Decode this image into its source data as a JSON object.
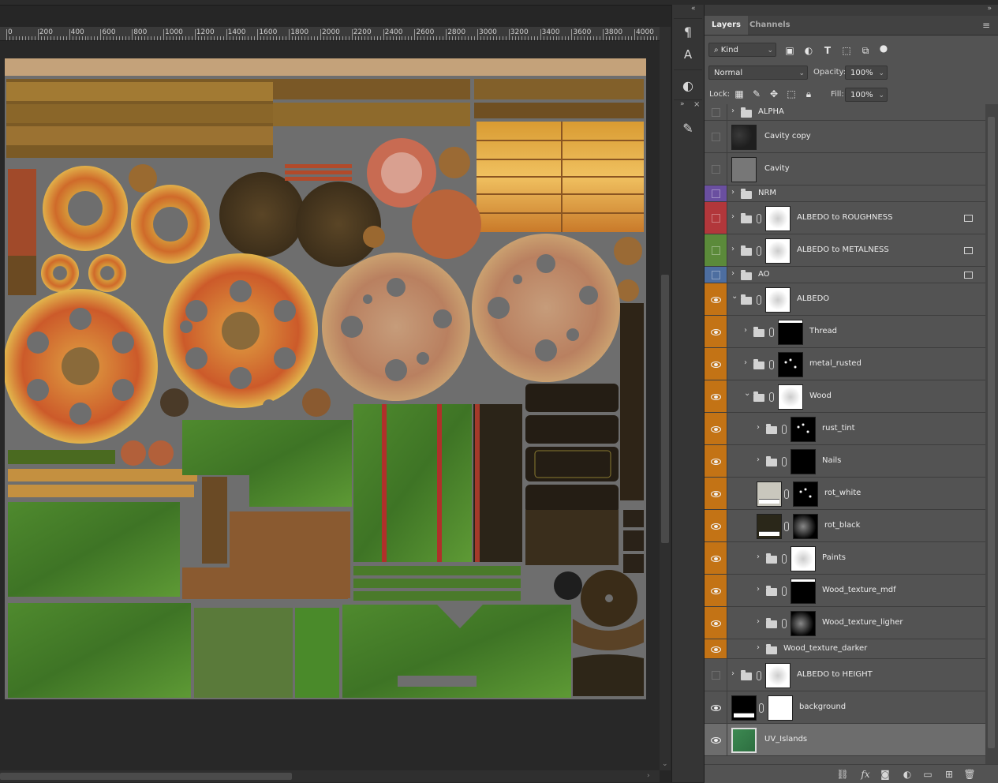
{
  "ruler": {
    "labels": [
      "0",
      "200",
      "400",
      "600",
      "800",
      "1000",
      "1200",
      "1400",
      "1600",
      "1800",
      "2000",
      "2200",
      "2400",
      "2600",
      "2800",
      "3000",
      "3200",
      "3400",
      "3600",
      "3800",
      "4000"
    ]
  },
  "dock": {
    "collapse_glyph": "«",
    "expand_glyph": "»",
    "close_glyph": "×"
  },
  "panel": {
    "collapse_glyph": "»",
    "tabs": [
      "Layers",
      "Channels"
    ],
    "menu_glyph": "≡",
    "filter": {
      "label": "Kind",
      "search_glyph": "⌕"
    },
    "blend_mode": "Normal",
    "opacity": {
      "label": "Opacity:",
      "value": "100%"
    },
    "lock": {
      "label": "Lock:"
    },
    "fill": {
      "label": "Fill:",
      "value": "100%"
    }
  },
  "colors": {
    "purple": "#6a4fa0",
    "red": "#b2373b",
    "green": "#5b8a3a",
    "blue": "#4d6ea0",
    "orange": "#c37315",
    "selected": "#6d6d6d"
  },
  "layers": [
    {
      "name": "ALPHA",
      "type": "group",
      "visible": false,
      "color": "",
      "indent": 0,
      "expanded": false
    },
    {
      "name": "Cavity copy",
      "type": "pixel",
      "visible": false,
      "color": "",
      "indent": 0,
      "thumb": "dark-noise"
    },
    {
      "name": "Cavity",
      "type": "pixel",
      "visible": false,
      "color": "",
      "indent": 0,
      "thumb": "gray"
    },
    {
      "name": "NRM",
      "type": "group",
      "visible": false,
      "color": "purple",
      "indent": 0,
      "expanded": false
    },
    {
      "name": "ALBEDO to ROUGHNESS",
      "type": "group-mask",
      "visible": false,
      "color": "red",
      "indent": 0,
      "expanded": false,
      "badge": true
    },
    {
      "name": "ALBEDO to METALNESS",
      "type": "group-mask",
      "visible": false,
      "color": "green",
      "indent": 0,
      "expanded": false,
      "badge": true
    },
    {
      "name": "AO",
      "type": "group",
      "visible": false,
      "color": "blue",
      "indent": 0,
      "expanded": false,
      "badge": true
    },
    {
      "name": "ALBEDO",
      "type": "group-mask",
      "visible": true,
      "color": "orange",
      "indent": 0,
      "expanded": true
    },
    {
      "name": "Thread",
      "type": "group-mask",
      "visible": true,
      "color": "orange",
      "indent": 1,
      "expanded": false,
      "mask": "black-white-top"
    },
    {
      "name": "metal_rusted",
      "type": "group-mask",
      "visible": true,
      "color": "orange",
      "indent": 1,
      "expanded": false,
      "mask": "black-dots"
    },
    {
      "name": "Wood",
      "type": "group-mask",
      "visible": true,
      "color": "orange",
      "indent": 1,
      "expanded": true,
      "mask": "white-noise"
    },
    {
      "name": "rust_tint",
      "type": "group-mask",
      "visible": true,
      "color": "orange",
      "indent": 2,
      "expanded": false,
      "mask": "black-dots"
    },
    {
      "name": "Nails",
      "type": "group-mask",
      "visible": true,
      "color": "orange",
      "indent": 2,
      "expanded": false,
      "mask": "black"
    },
    {
      "name": "rot_white",
      "type": "fill-mask",
      "visible": true,
      "color": "orange",
      "indent": 2,
      "fill": "#c9c7bd",
      "mask": "black-dots"
    },
    {
      "name": "rot_black",
      "type": "fill-mask",
      "visible": true,
      "color": "orange",
      "indent": 2,
      "fill": "#2a2719",
      "mask": "black-noise"
    },
    {
      "name": "Paints",
      "type": "group-mask",
      "visible": true,
      "color": "orange",
      "indent": 2,
      "expanded": false,
      "mask": "white-noise"
    },
    {
      "name": "Wood_texture_mdf",
      "type": "group-mask",
      "visible": true,
      "color": "orange",
      "indent": 2,
      "expanded": false,
      "mask": "black-white-top"
    },
    {
      "name": "Wood_texture_ligher",
      "type": "group-mask",
      "visible": true,
      "color": "orange",
      "indent": 2,
      "expanded": false,
      "mask": "black-noise"
    },
    {
      "name": "Wood_texture_darker",
      "type": "group",
      "visible": true,
      "color": "orange",
      "indent": 2,
      "expanded": false,
      "short": true
    },
    {
      "name": "ALBEDO to HEIGHT",
      "type": "group-mask",
      "visible": false,
      "color": "",
      "indent": 0,
      "expanded": false
    },
    {
      "name": "background",
      "type": "fill-mask",
      "visible": true,
      "color": "",
      "indent": 0,
      "fill": "#000000",
      "mask": "white"
    },
    {
      "name": "UV_Islands",
      "type": "pixel",
      "visible": true,
      "color": "",
      "indent": 0,
      "thumb": "green-uv",
      "selected": true
    }
  ]
}
